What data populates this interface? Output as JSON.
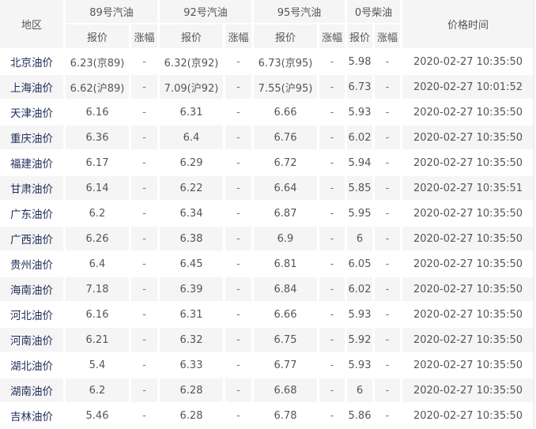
{
  "table": {
    "headers": {
      "region": "地区",
      "groups": [
        "89号汽油",
        "92号汽油",
        "95号汽油",
        "0号柴油"
      ],
      "sub": {
        "price": "报价",
        "change": "涨幅"
      },
      "time": "价格时间"
    },
    "rows": [
      {
        "region": "北京油价",
        "p89": "6.23(京89)",
        "c89": "-",
        "p92": "6.32(京92)",
        "c92": "-",
        "p95": "6.73(京95)",
        "c95": "-",
        "p0": "5.98",
        "c0": "-",
        "time": "2020-02-27 10:35:50"
      },
      {
        "region": "上海油价",
        "p89": "6.62(沪89)",
        "c89": "-",
        "p92": "7.09(沪92)",
        "c92": "-",
        "p95": "7.55(沪95)",
        "c95": "-",
        "p0": "6.73",
        "c0": "-",
        "time": "2020-02-27 10:01:52"
      },
      {
        "region": "天津油价",
        "p89": "6.16",
        "c89": "-",
        "p92": "6.31",
        "c92": "-",
        "p95": "6.66",
        "c95": "-",
        "p0": "5.93",
        "c0": "-",
        "time": "2020-02-27 10:35:50"
      },
      {
        "region": "重庆油价",
        "p89": "6.36",
        "c89": "-",
        "p92": "6.4",
        "c92": "-",
        "p95": "6.76",
        "c95": "-",
        "p0": "6.02",
        "c0": "-",
        "time": "2020-02-27 10:35:50"
      },
      {
        "region": "福建油价",
        "p89": "6.17",
        "c89": "-",
        "p92": "6.29",
        "c92": "-",
        "p95": "6.72",
        "c95": "-",
        "p0": "5.94",
        "c0": "-",
        "time": "2020-02-27 10:35:50"
      },
      {
        "region": "甘肃油价",
        "p89": "6.14",
        "c89": "-",
        "p92": "6.22",
        "c92": "-",
        "p95": "6.64",
        "c95": "-",
        "p0": "5.85",
        "c0": "-",
        "time": "2020-02-27 10:35:51"
      },
      {
        "region": "广东油价",
        "p89": "6.2",
        "c89": "-",
        "p92": "6.34",
        "c92": "-",
        "p95": "6.87",
        "c95": "-",
        "p0": "5.95",
        "c0": "-",
        "time": "2020-02-27 10:35:50"
      },
      {
        "region": "广西油价",
        "p89": "6.26",
        "c89": "-",
        "p92": "6.38",
        "c92": "-",
        "p95": "6.9",
        "c95": "-",
        "p0": "6",
        "c0": "-",
        "time": "2020-02-27 10:35:50"
      },
      {
        "region": "贵州油价",
        "p89": "6.4",
        "c89": "-",
        "p92": "6.45",
        "c92": "-",
        "p95": "6.81",
        "c95": "-",
        "p0": "6.05",
        "c0": "-",
        "time": "2020-02-27 10:35:50"
      },
      {
        "region": "海南油价",
        "p89": "7.18",
        "c89": "-",
        "p92": "6.39",
        "c92": "-",
        "p95": "6.84",
        "c95": "-",
        "p0": "6.02",
        "c0": "-",
        "time": "2020-02-27 10:35:50"
      },
      {
        "region": "河北油价",
        "p89": "6.16",
        "c89": "-",
        "p92": "6.31",
        "c92": "-",
        "p95": "6.66",
        "c95": "-",
        "p0": "5.93",
        "c0": "-",
        "time": "2020-02-27 10:35:50"
      },
      {
        "region": "河南油价",
        "p89": "6.21",
        "c89": "-",
        "p92": "6.32",
        "c92": "-",
        "p95": "6.75",
        "c95": "-",
        "p0": "5.92",
        "c0": "-",
        "time": "2020-02-27 10:35:50"
      },
      {
        "region": "湖北油价",
        "p89": "5.4",
        "c89": "-",
        "p92": "6.33",
        "c92": "-",
        "p95": "6.77",
        "c95": "-",
        "p0": "5.93",
        "c0": "-",
        "time": "2020-02-27 10:35:50"
      },
      {
        "region": "湖南油价",
        "p89": "6.2",
        "c89": "-",
        "p92": "6.28",
        "c92": "-",
        "p95": "6.68",
        "c95": "-",
        "p0": "6",
        "c0": "-",
        "time": "2020-02-27 10:35:50"
      },
      {
        "region": "吉林油价",
        "p89": "5.46",
        "c89": "-",
        "p92": "6.28",
        "c92": "-",
        "p95": "6.78",
        "c95": "-",
        "p0": "5.86",
        "c0": "-",
        "time": "2020-02-27 10:35:50"
      }
    ]
  }
}
